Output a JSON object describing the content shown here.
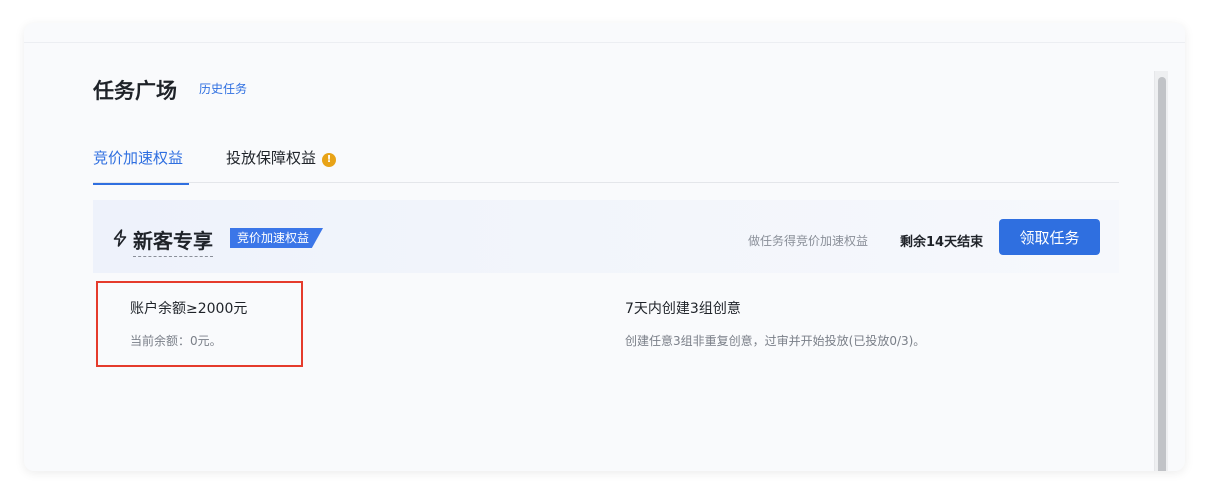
{
  "page": {
    "title": "任务广场",
    "history_link": "历史任务"
  },
  "tabs": [
    {
      "label": "竞价加速权益",
      "active": true
    },
    {
      "label": "投放保障权益",
      "active": false,
      "has_warning": true,
      "warning_glyph": "!"
    }
  ],
  "section": {
    "icon": "lightning-icon",
    "title": "新客专享",
    "badge": "竞价加速权益",
    "description": "做任务得竞价加速权益",
    "remaining": "剩余14天结束",
    "button_label": "领取任务"
  },
  "tasks": [
    {
      "title": "账户余额≥2000元",
      "description": "当前余额：0元。"
    },
    {
      "title": "7天内创建3组创意",
      "description": "创建任意3组非重复创意，过审并开始投放(已投放0/3)。"
    }
  ],
  "colors": {
    "accent": "#2f6fe0",
    "warning": "#e8a317",
    "highlight": "#e53b2c"
  }
}
